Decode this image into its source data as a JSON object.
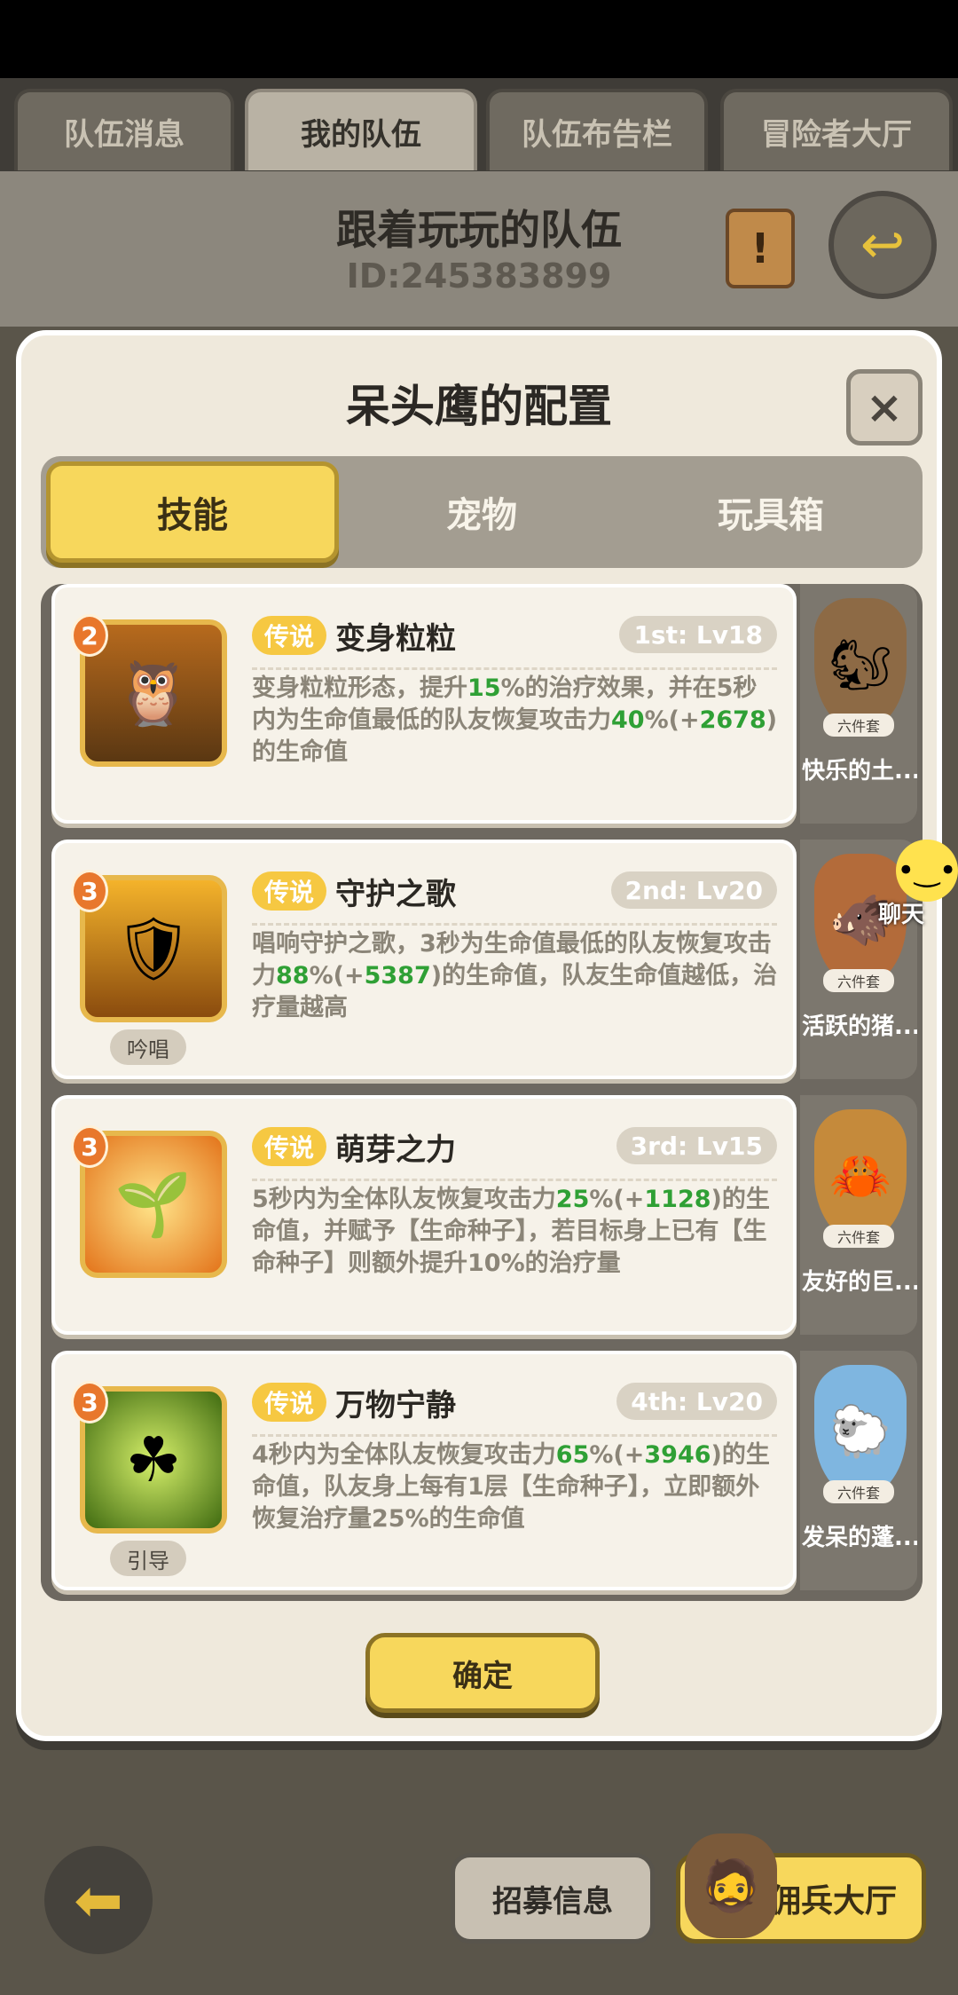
{
  "top_tabs": [
    "队伍消息",
    "我的队伍",
    "队伍布告栏",
    "冒险者大厅"
  ],
  "team": {
    "name": "跟着玩玩的队伍",
    "id": "ID:245383899"
  },
  "dialog": {
    "title": "呆头鹰的配置",
    "close": "×",
    "tabs": [
      "技能",
      "宠物",
      "玩具箱"
    ],
    "confirm": "确定"
  },
  "skills": [
    {
      "rank": "2",
      "rarity": "传说",
      "name": "变身粒粒",
      "level": "1st: Lv18",
      "cast": "",
      "desc": [
        "变身粒粒形态，提升",
        "15",
        "%的治疗效果，并在5秒内为生命值最低的队友恢复攻击力",
        "40",
        "%(+",
        "2678",
        ")的生命值"
      ],
      "icon": "owl-icon"
    },
    {
      "rank": "3",
      "rarity": "传说",
      "name": "守护之歌",
      "level": "2nd: Lv20",
      "cast": "吟唱",
      "desc": [
        "唱响守护之歌，3秒为生命值最低的队友恢复攻击力",
        "88",
        "%(+",
        "5387",
        ")的生命值，队友生命值越低，治疗量越高"
      ],
      "icon": "shield-icon"
    },
    {
      "rank": "3",
      "rarity": "传说",
      "name": "萌芽之力",
      "level": "3rd: Lv15",
      "cast": "",
      "desc": [
        "5秒内为全体队友恢复攻击力",
        "25",
        "%(+",
        "1128",
        ")的生命值，并赋予【生命种子】，若目标身上已有【生命种子】则额外提升10%的治疗量"
      ],
      "icon": "sprout-icon"
    },
    {
      "rank": "3",
      "rarity": "传说",
      "name": "万物宁静",
      "level": "4th: Lv20",
      "cast": "引导",
      "desc": [
        "4秒内为全体队友恢复攻击力",
        "65",
        "%(+",
        "3946",
        ")的生命值，队友身上每有1层【生命种子】，立即额外恢复治疗量25%的生命值"
      ],
      "icon": "clover-icon"
    }
  ],
  "pets": [
    {
      "name": "快乐的土...",
      "tag": "六件套",
      "icon": "squirrel-icon"
    },
    {
      "name": "活跃的猪...",
      "tag": "六件套",
      "icon": "boar-icon"
    },
    {
      "name": "友好的巨...",
      "tag": "六件套",
      "icon": "crab-icon"
    },
    {
      "name": "发呆的蓬...",
      "tag": "六件套",
      "icon": "sheep-icon"
    }
  ],
  "chat": {
    "label": "聊天"
  },
  "bottom": {
    "recruit": "招募信息",
    "mercenary": "佣兵大厅"
  },
  "colors": {
    "accent_yellow": "#f7d75c",
    "highlight_green": "#2fa035",
    "rarity_gold": "#f6c842"
  }
}
